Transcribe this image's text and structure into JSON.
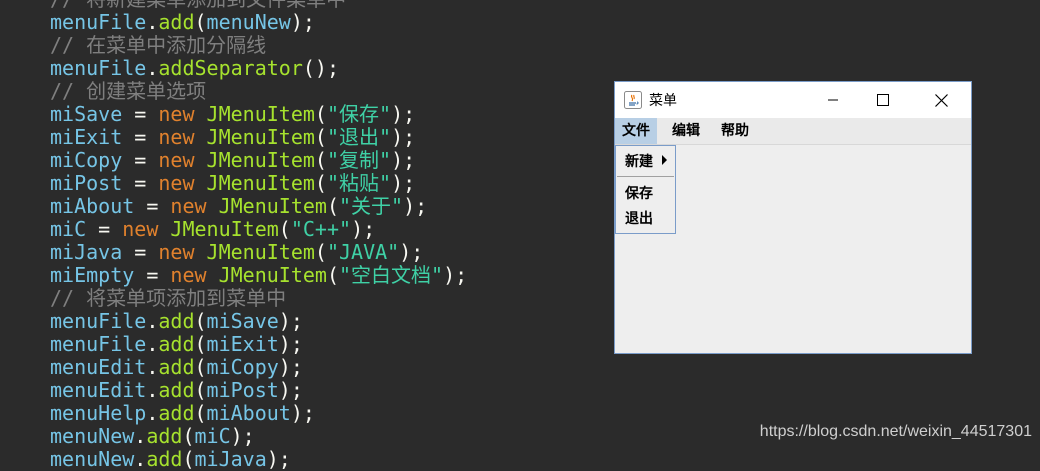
{
  "editor": {
    "lines": [
      {
        "tokens": [
          {
            "t": "comment",
            "v": "// 将新建菜单添加到文件菜单中"
          }
        ]
      },
      {
        "tokens": [
          {
            "t": "ident",
            "v": "menuFile"
          },
          {
            "t": "punct",
            "v": "."
          },
          {
            "t": "func",
            "v": "add"
          },
          {
            "t": "punct",
            "v": "("
          },
          {
            "t": "ident",
            "v": "menuNew"
          },
          {
            "t": "punct",
            "v": ");"
          }
        ]
      },
      {
        "tokens": [
          {
            "t": "comment",
            "v": "// 在菜单中添加分隔线"
          }
        ]
      },
      {
        "tokens": [
          {
            "t": "ident",
            "v": "menuFile"
          },
          {
            "t": "punct",
            "v": "."
          },
          {
            "t": "func",
            "v": "addSeparator"
          },
          {
            "t": "punct",
            "v": "();"
          }
        ]
      },
      {
        "tokens": [
          {
            "t": "comment",
            "v": "// 创建菜单选项"
          }
        ]
      },
      {
        "tokens": [
          {
            "t": "ident",
            "v": "miSave"
          },
          {
            "t": "op",
            "v": " = "
          },
          {
            "t": "keyword",
            "v": "new "
          },
          {
            "t": "class",
            "v": "JMenuItem"
          },
          {
            "t": "punct",
            "v": "("
          },
          {
            "t": "string",
            "v": "\"保存\""
          },
          {
            "t": "punct",
            "v": ");"
          }
        ]
      },
      {
        "tokens": [
          {
            "t": "ident",
            "v": "miExit"
          },
          {
            "t": "op",
            "v": " = "
          },
          {
            "t": "keyword",
            "v": "new "
          },
          {
            "t": "class",
            "v": "JMenuItem"
          },
          {
            "t": "punct",
            "v": "("
          },
          {
            "t": "string",
            "v": "\"退出\""
          },
          {
            "t": "punct",
            "v": ");"
          }
        ]
      },
      {
        "tokens": [
          {
            "t": "ident",
            "v": "miCopy"
          },
          {
            "t": "op",
            "v": " = "
          },
          {
            "t": "keyword",
            "v": "new "
          },
          {
            "t": "class",
            "v": "JMenuItem"
          },
          {
            "t": "punct",
            "v": "("
          },
          {
            "t": "string",
            "v": "\"复制\""
          },
          {
            "t": "punct",
            "v": ");"
          }
        ]
      },
      {
        "tokens": [
          {
            "t": "ident",
            "v": "miPost"
          },
          {
            "t": "op",
            "v": " = "
          },
          {
            "t": "keyword",
            "v": "new "
          },
          {
            "t": "class",
            "v": "JMenuItem"
          },
          {
            "t": "punct",
            "v": "("
          },
          {
            "t": "string",
            "v": "\"粘贴\""
          },
          {
            "t": "punct",
            "v": ");"
          }
        ]
      },
      {
        "tokens": [
          {
            "t": "ident",
            "v": "miAbout"
          },
          {
            "t": "op",
            "v": " = "
          },
          {
            "t": "keyword",
            "v": "new "
          },
          {
            "t": "class",
            "v": "JMenuItem"
          },
          {
            "t": "punct",
            "v": "("
          },
          {
            "t": "string",
            "v": "\"关于\""
          },
          {
            "t": "punct",
            "v": ");"
          }
        ]
      },
      {
        "tokens": [
          {
            "t": "ident",
            "v": "miC"
          },
          {
            "t": "op",
            "v": " = "
          },
          {
            "t": "keyword",
            "v": "new "
          },
          {
            "t": "class",
            "v": "JMenuItem"
          },
          {
            "t": "punct",
            "v": "("
          },
          {
            "t": "string",
            "v": "\"C++\""
          },
          {
            "t": "punct",
            "v": ");"
          }
        ]
      },
      {
        "tokens": [
          {
            "t": "ident",
            "v": "miJava"
          },
          {
            "t": "op",
            "v": " = "
          },
          {
            "t": "keyword",
            "v": "new "
          },
          {
            "t": "class",
            "v": "JMenuItem"
          },
          {
            "t": "punct",
            "v": "("
          },
          {
            "t": "string",
            "v": "\"JAVA\""
          },
          {
            "t": "punct",
            "v": ");"
          }
        ]
      },
      {
        "tokens": [
          {
            "t": "ident",
            "v": "miEmpty"
          },
          {
            "t": "op",
            "v": " = "
          },
          {
            "t": "keyword",
            "v": "new "
          },
          {
            "t": "class",
            "v": "JMenuItem"
          },
          {
            "t": "punct",
            "v": "("
          },
          {
            "t": "string",
            "v": "\"空白文档\""
          },
          {
            "t": "punct",
            "v": ");"
          }
        ]
      },
      {
        "tokens": [
          {
            "t": "comment",
            "v": "// 将菜单项添加到菜单中"
          }
        ]
      },
      {
        "tokens": [
          {
            "t": "ident",
            "v": "menuFile"
          },
          {
            "t": "punct",
            "v": "."
          },
          {
            "t": "func",
            "v": "add"
          },
          {
            "t": "punct",
            "v": "("
          },
          {
            "t": "ident",
            "v": "miSave"
          },
          {
            "t": "punct",
            "v": ");"
          }
        ]
      },
      {
        "tokens": [
          {
            "t": "ident",
            "v": "menuFile"
          },
          {
            "t": "punct",
            "v": "."
          },
          {
            "t": "func",
            "v": "add"
          },
          {
            "t": "punct",
            "v": "("
          },
          {
            "t": "ident",
            "v": "miExit"
          },
          {
            "t": "punct",
            "v": ");"
          }
        ]
      },
      {
        "tokens": [
          {
            "t": "ident",
            "v": "menuEdit"
          },
          {
            "t": "punct",
            "v": "."
          },
          {
            "t": "func",
            "v": "add"
          },
          {
            "t": "punct",
            "v": "("
          },
          {
            "t": "ident",
            "v": "miCopy"
          },
          {
            "t": "punct",
            "v": ");"
          }
        ]
      },
      {
        "tokens": [
          {
            "t": "ident",
            "v": "menuEdit"
          },
          {
            "t": "punct",
            "v": "."
          },
          {
            "t": "func",
            "v": "add"
          },
          {
            "t": "punct",
            "v": "("
          },
          {
            "t": "ident",
            "v": "miPost"
          },
          {
            "t": "punct",
            "v": ");"
          }
        ]
      },
      {
        "tokens": [
          {
            "t": "ident",
            "v": "menuHelp"
          },
          {
            "t": "punct",
            "v": "."
          },
          {
            "t": "func",
            "v": "add"
          },
          {
            "t": "punct",
            "v": "("
          },
          {
            "t": "ident",
            "v": "miAbout"
          },
          {
            "t": "punct",
            "v": ");"
          }
        ]
      },
      {
        "tokens": [
          {
            "t": "ident",
            "v": "menuNew"
          },
          {
            "t": "punct",
            "v": "."
          },
          {
            "t": "func",
            "v": "add"
          },
          {
            "t": "punct",
            "v": "("
          },
          {
            "t": "ident",
            "v": "miC"
          },
          {
            "t": "punct",
            "v": ");"
          }
        ]
      },
      {
        "tokens": [
          {
            "t": "ident",
            "v": "menuNew"
          },
          {
            "t": "punct",
            "v": "."
          },
          {
            "t": "func",
            "v": "add"
          },
          {
            "t": "punct",
            "v": "("
          },
          {
            "t": "ident",
            "v": "miJava"
          },
          {
            "t": "punct",
            "v": ");"
          }
        ]
      }
    ]
  },
  "window": {
    "title": "菜单",
    "menus": {
      "file": "文件",
      "edit": "编辑",
      "help": "帮助"
    },
    "popup": {
      "new_label": "新建",
      "save_label": "保存",
      "exit_label": "退出"
    }
  },
  "watermark": "https://blog.csdn.net/weixin_44517301",
  "colors": {
    "editor_bg": "#2b2b2b",
    "menu_active": "#b8cfe5",
    "window_border": "#7a9cc9"
  }
}
